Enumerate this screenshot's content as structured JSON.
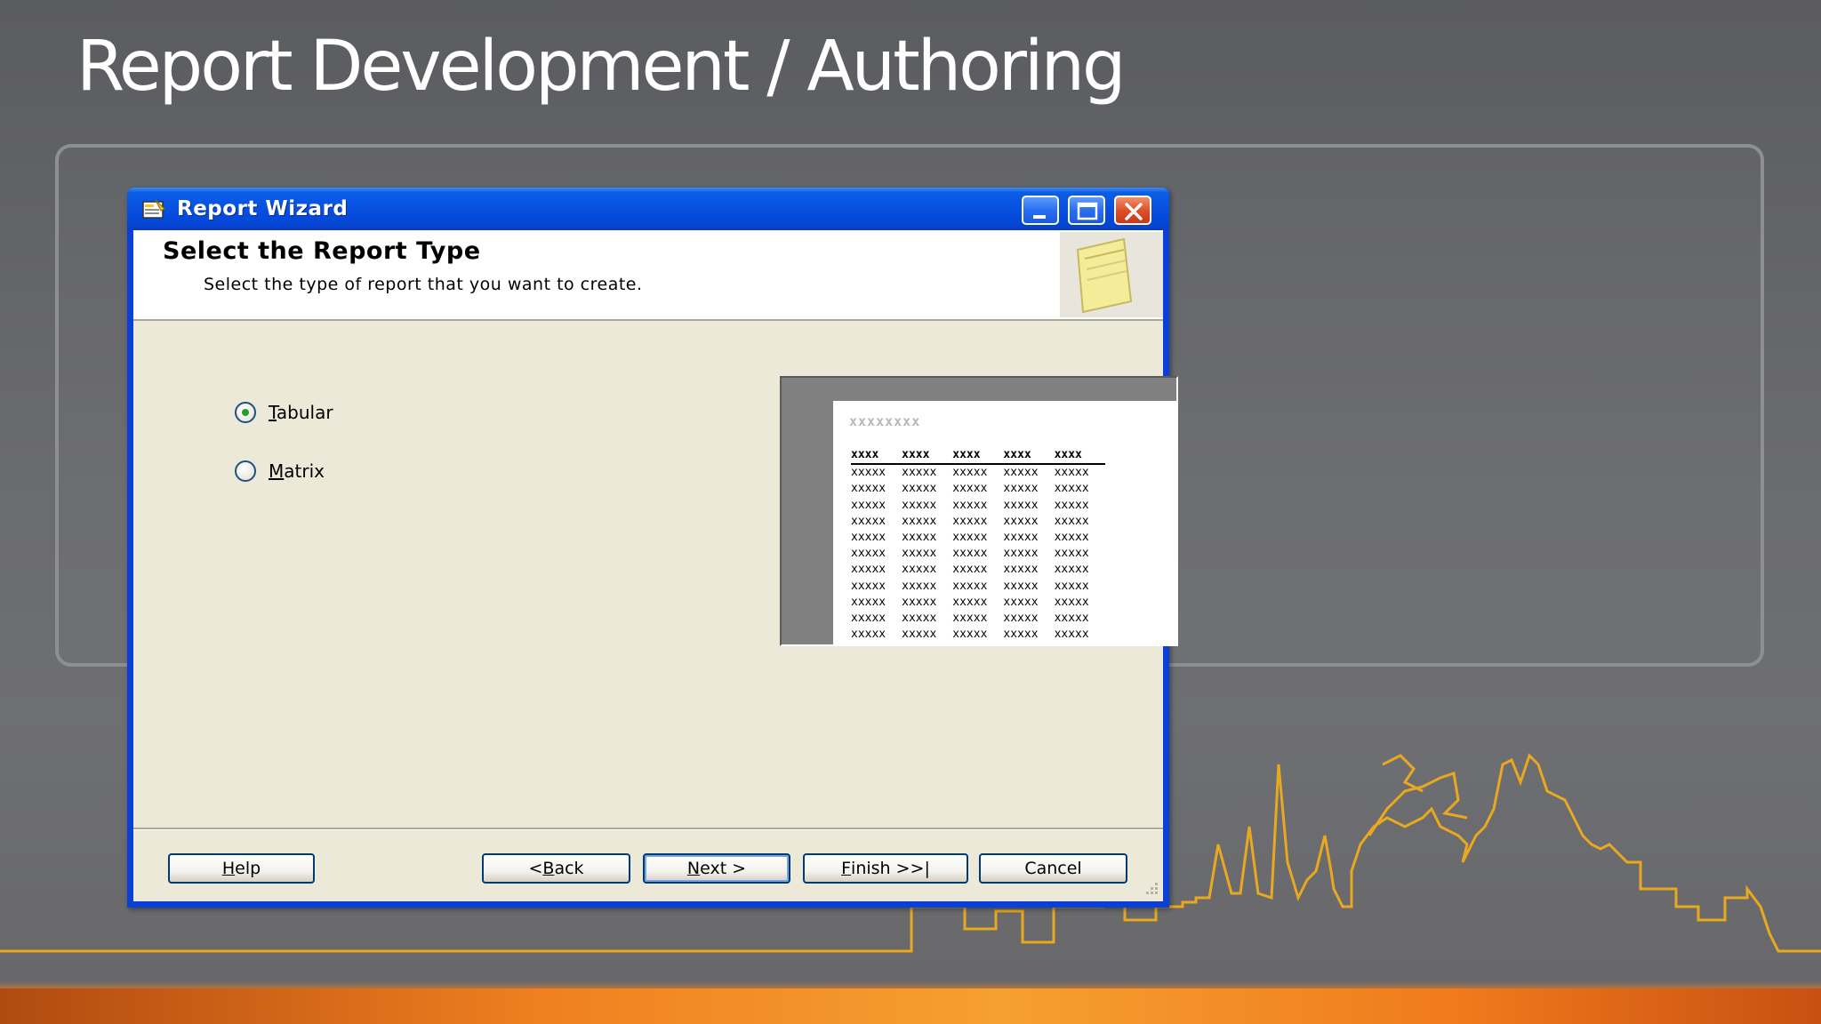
{
  "slide": {
    "title": "Report Development / Authoring"
  },
  "window": {
    "title": "Report Wizard",
    "controls": [
      "minimize-icon",
      "maximize-icon",
      "close-icon"
    ]
  },
  "header": {
    "title": "Select the Report Type",
    "subtitle": "Select the type of report that you want to create."
  },
  "options": [
    {
      "label": "Tabular",
      "mnemonic": "T",
      "rest": "abular",
      "selected": true
    },
    {
      "label": "Matrix",
      "mnemonic": "M",
      "rest": "atrix",
      "selected": false
    }
  ],
  "preview": {
    "title": "xxxxxxxx",
    "headers": [
      "xxxx",
      "xxxx",
      "xxxx",
      "xxxx",
      "xxxx"
    ],
    "rows": [
      [
        "xxxxx",
        "xxxxx",
        "xxxxx",
        "xxxxx",
        "xxxxx"
      ],
      [
        "xxxxx",
        "xxxxx",
        "xxxxx",
        "xxxxx",
        "xxxxx"
      ],
      [
        "xxxxx",
        "xxxxx",
        "xxxxx",
        "xxxxx",
        "xxxxx"
      ],
      [
        "xxxxx",
        "xxxxx",
        "xxxxx",
        "xxxxx",
        "xxxxx"
      ],
      [
        "xxxxx",
        "xxxxx",
        "xxxxx",
        "xxxxx",
        "xxxxx"
      ],
      [
        "xxxxx",
        "xxxxx",
        "xxxxx",
        "xxxxx",
        "xxxxx"
      ],
      [
        "xxxxx",
        "xxxxx",
        "xxxxx",
        "xxxxx",
        "xxxxx"
      ],
      [
        "xxxxx",
        "xxxxx",
        "xxxxx",
        "xxxxx",
        "xxxxx"
      ],
      [
        "xxxxx",
        "xxxxx",
        "xxxxx",
        "xxxxx",
        "xxxxx"
      ],
      [
        "xxxxx",
        "xxxxx",
        "xxxxx",
        "xxxxx",
        "xxxxx"
      ],
      [
        "xxxxx",
        "xxxxx",
        "xxxxx",
        "xxxxx",
        "xxxxx"
      ]
    ]
  },
  "buttons": {
    "help": {
      "label": "Help",
      "mnemonic": "H",
      "rest": "elp"
    },
    "back": {
      "label": "< Back",
      "prefix": "< ",
      "mnemonic": "B",
      "rest": "ack"
    },
    "next": {
      "label": "Next >",
      "mnemonic": "N",
      "rest": "ext >"
    },
    "finish": {
      "label": "Finish >>|",
      "mnemonic": "F",
      "rest": "inish >>|"
    },
    "cancel": {
      "label": "Cancel"
    }
  },
  "colors": {
    "titlebar": "#0750e0",
    "dialog_bg": "#ece9d8",
    "skyline": "#e8a820",
    "accent_bar": "#f08020"
  }
}
